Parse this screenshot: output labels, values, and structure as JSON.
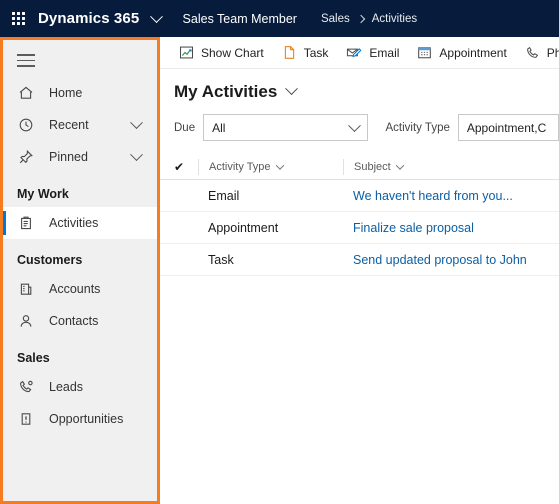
{
  "topbar": {
    "waffle_icon": "app-launcher-waffle-icon",
    "brand": "Dynamics 365",
    "brand_chevron_icon": "chevron-down-icon",
    "app_role": "Sales Team Member",
    "breadcrumb": [
      "Sales",
      "Activities"
    ],
    "breadcrumb_separator_icon": "chevron-right-icon",
    "background_color": "#071c3d"
  },
  "sidebar": {
    "highlight_color": "#f57c20",
    "background_color": "#f0f0f0",
    "selected_indicator_color": "#0078d4",
    "menu_icon": "hamburger-menu-icon",
    "items": [
      {
        "label": "Home",
        "icon": "home-icon",
        "expandable": false,
        "selected": false
      },
      {
        "label": "Recent",
        "icon": "clock-icon",
        "expandable": true,
        "selected": false
      },
      {
        "label": "Pinned",
        "icon": "pin-icon",
        "expandable": true,
        "selected": false
      }
    ],
    "groups": [
      {
        "title": "My Work",
        "items": [
          {
            "label": "Activities",
            "icon": "activities-clipboard-icon",
            "selected": true
          }
        ]
      },
      {
        "title": "Customers",
        "items": [
          {
            "label": "Accounts",
            "icon": "account-building-icon",
            "selected": false
          },
          {
            "label": "Contacts",
            "icon": "contact-person-icon",
            "selected": false
          }
        ]
      },
      {
        "title": "Sales",
        "items": [
          {
            "label": "Leads",
            "icon": "lead-phone-icon",
            "selected": false
          },
          {
            "label": "Opportunities",
            "icon": "opportunity-icon",
            "selected": false
          }
        ]
      }
    ]
  },
  "command_bar": {
    "buttons": [
      {
        "label": "Show Chart",
        "icon": "show-chart-icon"
      },
      {
        "label": "Task",
        "icon": "task-document-icon"
      },
      {
        "label": "Email",
        "icon": "email-envelope-pencil-icon"
      },
      {
        "label": "Appointment",
        "icon": "appointment-calendar-icon"
      },
      {
        "label": "Phone Call",
        "icon": "phone-call-handset-icon"
      }
    ]
  },
  "view": {
    "title": "My Activities",
    "title_chevron_icon": "chevron-down-icon"
  },
  "filters": {
    "due": {
      "label": "Due",
      "value": "All",
      "chevron_icon": "chevron-down-icon"
    },
    "activity_type": {
      "label": "Activity Type",
      "value": "Appointment,C",
      "chevron_icon": "chevron-down-icon"
    }
  },
  "grid": {
    "select_all_icon": "checkmark-icon",
    "columns": [
      {
        "label": "Activity Type",
        "sort_icon": "chevron-down-icon"
      },
      {
        "label": "Subject",
        "sort_icon": "chevron-down-icon"
      }
    ],
    "rows": [
      {
        "activity_type": "Email",
        "subject": "We haven't heard from you..."
      },
      {
        "activity_type": "Appointment",
        "subject": "Finalize sale proposal"
      },
      {
        "activity_type": "Task",
        "subject": "Send updated proposal to John"
      }
    ],
    "link_color": "#0b5fa5"
  }
}
